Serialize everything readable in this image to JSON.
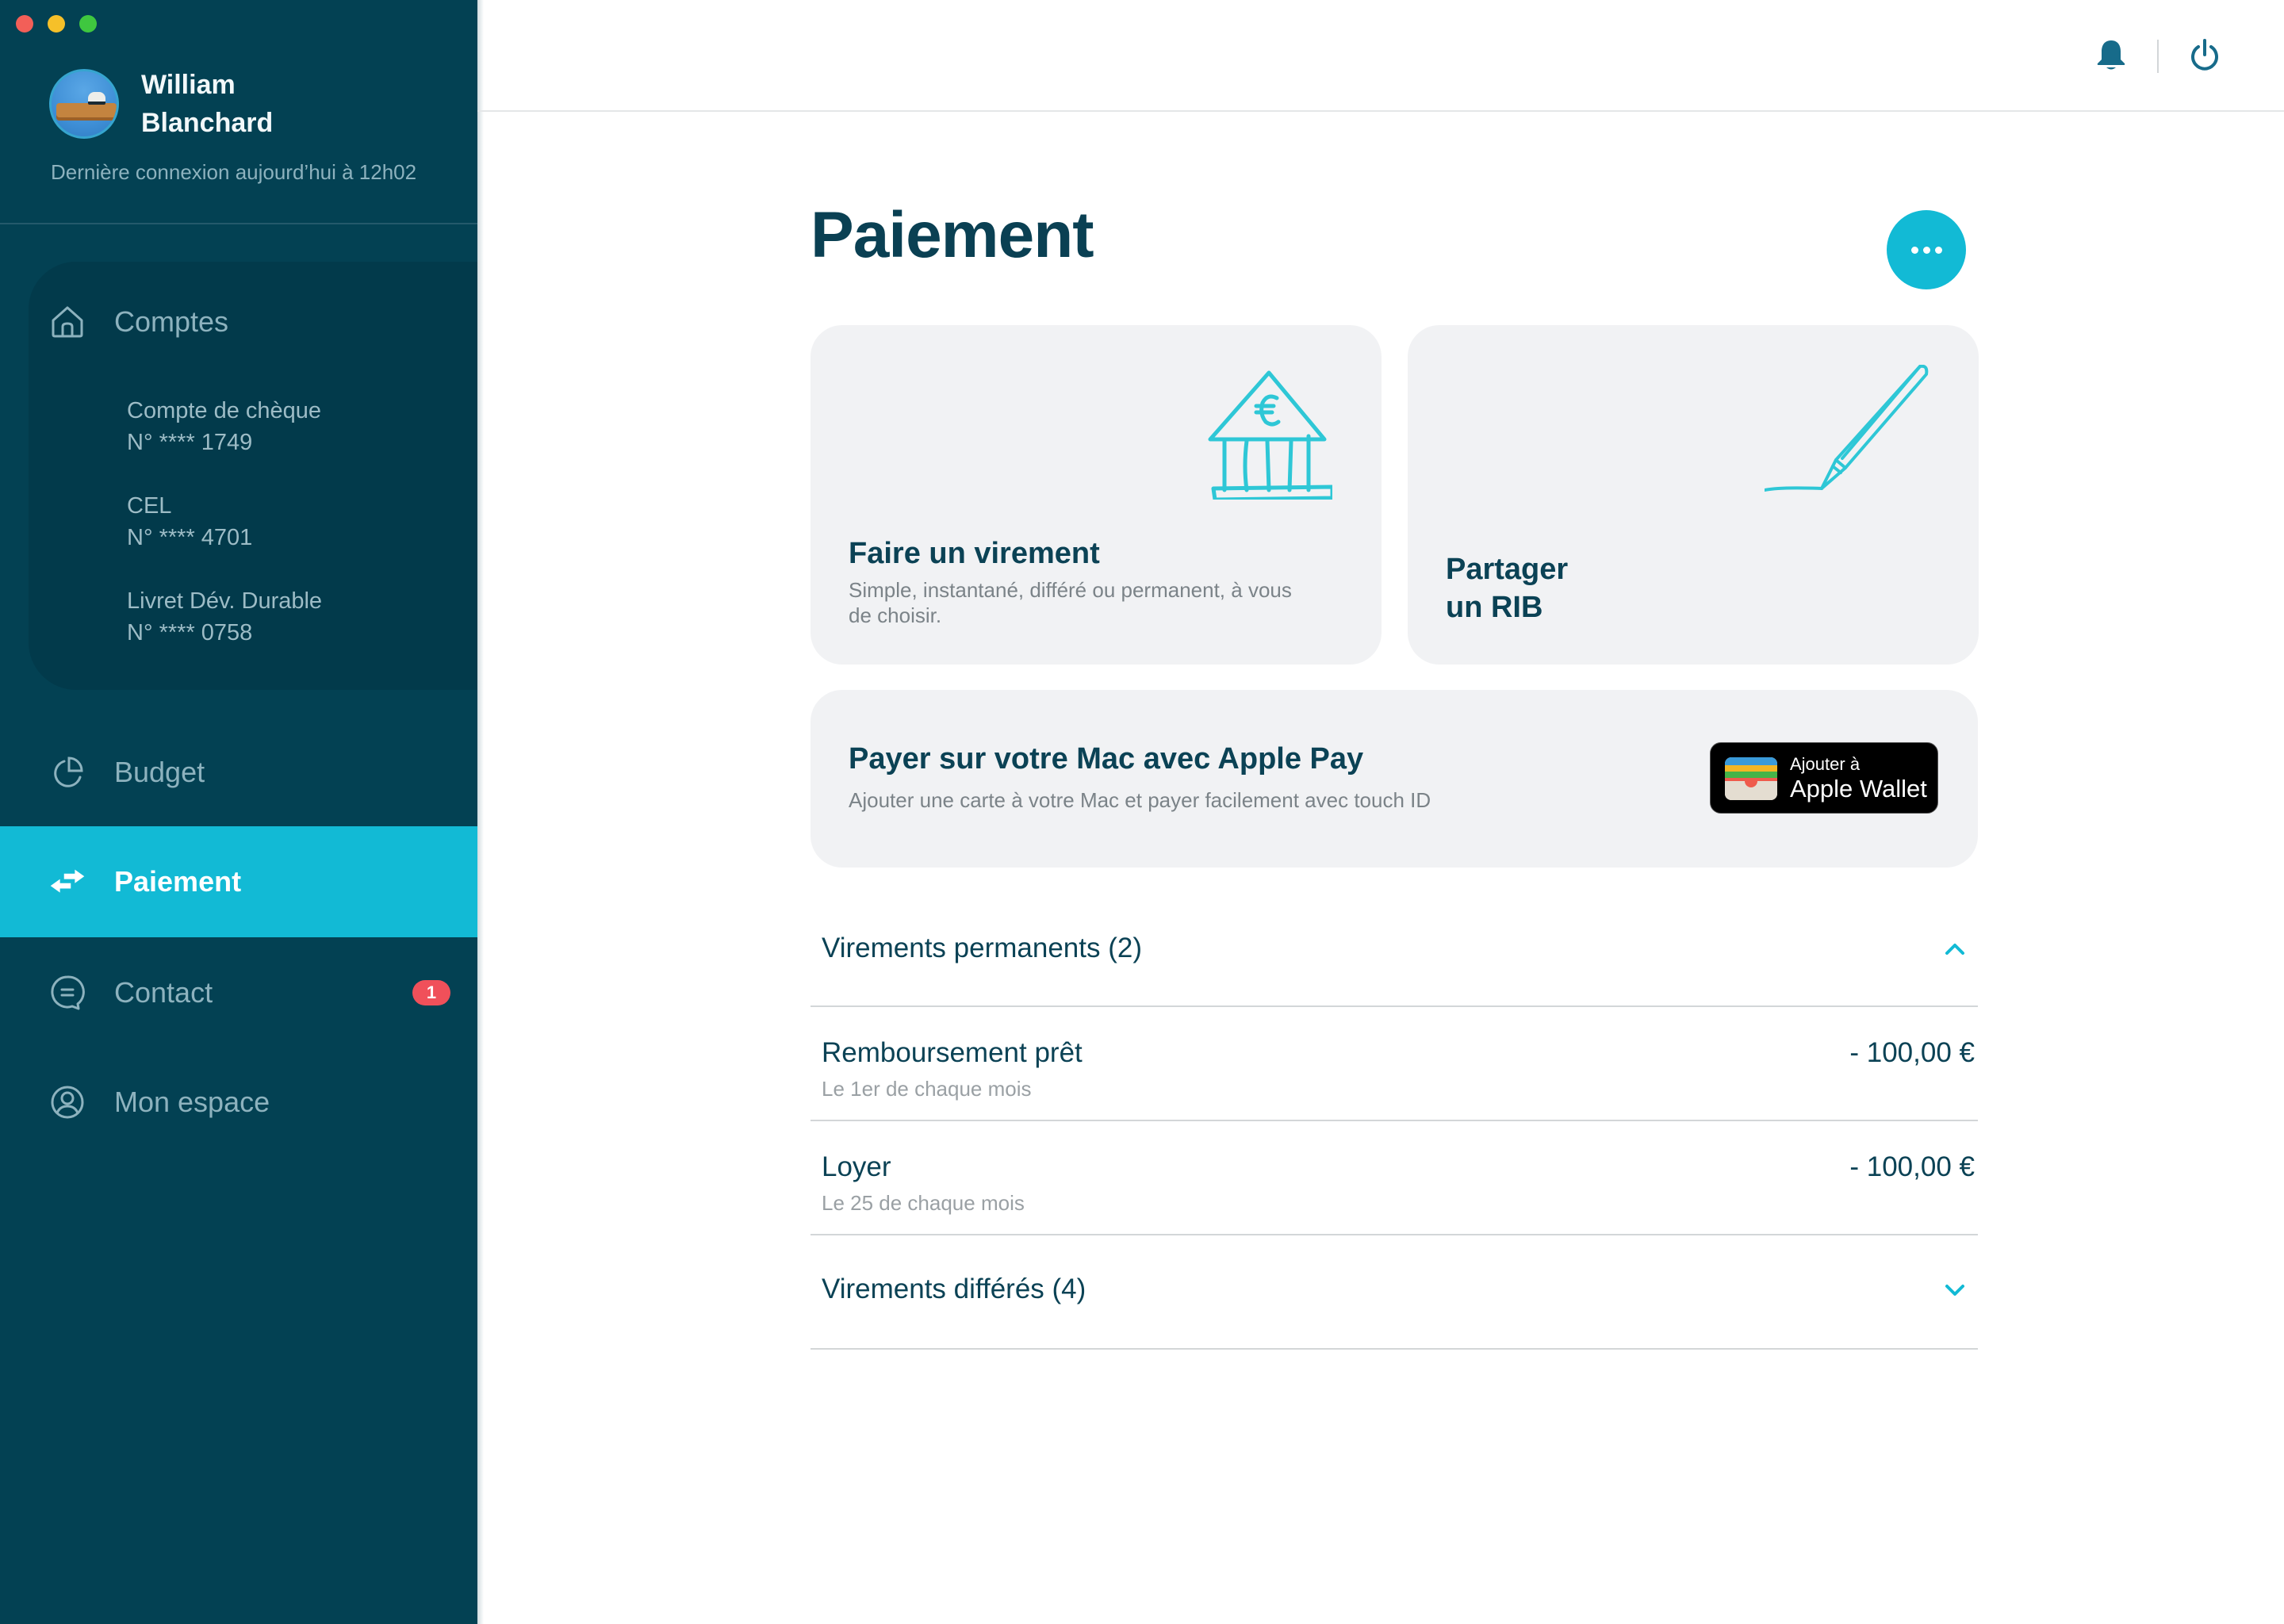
{
  "window": {
    "controls": [
      "close",
      "minimize",
      "maximize"
    ]
  },
  "user": {
    "first_name": "William",
    "last_name": "Blanchard",
    "last_login": "Dernière connexion aujourd’hui à 12h02"
  },
  "sidebar": {
    "comptes": {
      "label": "Comptes",
      "icon": "home-icon",
      "accounts": [
        {
          "name": "Compte de chèque",
          "number": "N° **** 1749"
        },
        {
          "name": "CEL",
          "number": "N° **** 4701"
        },
        {
          "name": "Livret Dév. Durable",
          "number": "N° **** 0758"
        }
      ]
    },
    "items": [
      {
        "label": "Budget",
        "icon": "pie-chart-icon",
        "active": false
      },
      {
        "label": "Paiement",
        "icon": "transfer-arrows-icon",
        "active": true
      },
      {
        "label": "Contact",
        "icon": "chat-bubble-icon",
        "active": false,
        "badge": "1"
      },
      {
        "label": "Mon espace",
        "icon": "user-circle-icon",
        "active": false
      }
    ]
  },
  "topbar": {
    "notifications_icon": "bell-icon",
    "logout_icon": "power-icon"
  },
  "main": {
    "title": "Paiement",
    "more_button_icon": "more-dots-icon",
    "cards": {
      "transfer": {
        "title": "Faire un virement",
        "description": "Simple, instantané, différé ou permanent, à vous de choisir.",
        "illustration": "bank-euro-icon"
      },
      "rib": {
        "title_line1": "Partager",
        "title_line2": "un RIB",
        "illustration": "pen-signature-icon"
      },
      "apple_pay": {
        "title": "Payer sur votre Mac avec Apple Pay",
        "description": "Ajouter une carte à votre Mac et payer facilement avec touch ID",
        "wallet_button": {
          "small": "Ajouter à",
          "big": "Apple Wallet"
        }
      }
    },
    "sections": [
      {
        "label": "Virements permanents (2)",
        "expanded": true,
        "rows": [
          {
            "label": "Remboursement prêt",
            "schedule": "Le 1er de chaque mois",
            "amount": "- 100,00 €"
          },
          {
            "label": "Loyer",
            "schedule": "Le 25 de chaque mois",
            "amount": "- 100,00 €"
          }
        ]
      },
      {
        "label": "Virements différés (4)",
        "expanded": false,
        "rows": []
      }
    ]
  },
  "colors": {
    "sidebar_bg": "#034153",
    "accent": "#12bad5",
    "text_dark": "#0b4255",
    "badge": "#f0505a"
  }
}
